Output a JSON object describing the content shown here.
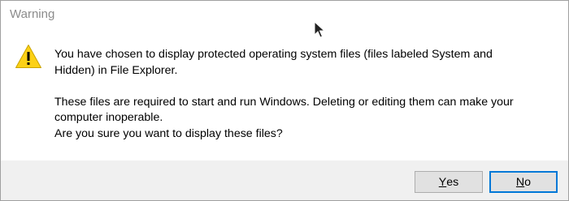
{
  "window": {
    "title": "Warning"
  },
  "icons": {
    "warning": "warning-triangle-icon",
    "cursor": "mouse-pointer-icon"
  },
  "message": {
    "line1": "You have chosen to display protected operating system files (files labeled System and",
    "line2": "Hidden) in File Explorer.",
    "line3": "These files are required to start and run Windows. Deleting or editing them can make your",
    "line4": "computer inoperable.",
    "line5": "Are you sure you want to display these files?"
  },
  "buttons": {
    "yes": {
      "mnemonic": "Y",
      "rest": "es"
    },
    "no": {
      "mnemonic": "N",
      "rest": "o"
    }
  },
  "colors": {
    "warning_fill": "#fcd116",
    "focus_border": "#0078d7",
    "footer_bg": "#f0f0f0"
  }
}
